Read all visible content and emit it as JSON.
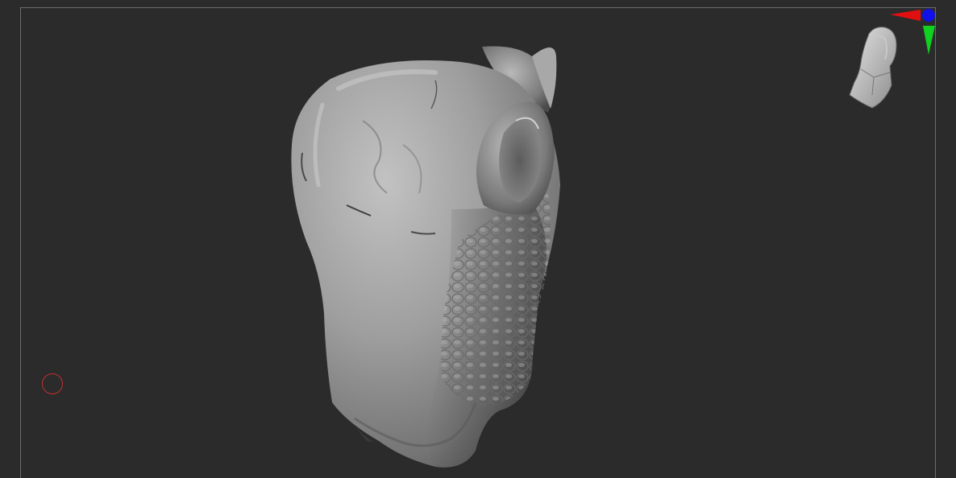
{
  "app": {
    "type": "3d-sculpting-viewport"
  },
  "viewport": {
    "background_color": "#2b2b2b",
    "frame_color": "#6b6b6b",
    "model": {
      "kind": "sculpted-creature-head",
      "material_color": "#9a9a9a"
    },
    "brush_cursor": {
      "color": "#c0302c",
      "icon": "brush-circle-icon"
    },
    "orientation_widget": {
      "icon": "head-orientation-icon",
      "axis_x_color": "#e01010",
      "axis_y_color": "#10d020",
      "axis_z_color": "#1010e8"
    }
  }
}
